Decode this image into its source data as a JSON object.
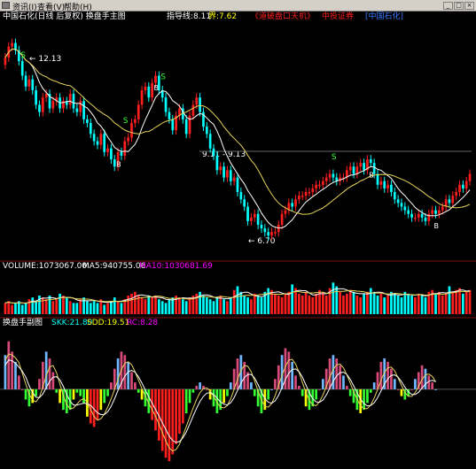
{
  "menu": {
    "items": [
      "资讯(I)",
      "查看(V)",
      "帮助(H)"
    ]
  },
  "main_panel": {
    "title": "中国石化(日线 后复权) 换盘手主图",
    "indicator": "指导线:8.11",
    "boundary": "界:7.62",
    "promo1": "《道破盘口天机》",
    "promo2": "中投证券",
    "stock_link": "[中国石化]",
    "annotations": {
      "high": "12.13",
      "mid": "9.11 - 9.13",
      "low": "6.70"
    },
    "markers": {
      "sell": "S",
      "buy": "B"
    }
  },
  "volume_panel": {
    "vol": "VOLUME:1073067.00",
    "ma5": "MA5:940755.06",
    "ma10": "MA10:1030681.69"
  },
  "sub_panel": {
    "name": "换盘手副图",
    "skk": "SKK:21.80",
    "sdd": "SDD:19.51",
    "rc": "RC:8.28"
  },
  "colors": {
    "up": "#ff1e1e",
    "down": "#00ffff",
    "ma5": "#ffffff",
    "ma10": "#e6d45c",
    "green": "#33ff33",
    "pink": "#d84a7a",
    "blue": "#70b8ff",
    "yellow": "#ffff00",
    "magenta_label": "#ff00ff",
    "cyan_label": "#00ffff",
    "yellow_label": "#ffff00"
  },
  "chart_data": {
    "type": "candlestick",
    "price_ylim": [
      6.2,
      12.6
    ],
    "close": [
      11.7,
      12.0,
      12.1,
      11.9,
      11.6,
      11.2,
      10.9,
      11.1,
      10.8,
      10.4,
      10.2,
      10.6,
      10.7,
      10.3,
      10.5,
      10.6,
      10.3,
      10.5,
      10.4,
      10.7,
      10.3,
      10.2,
      10.5,
      10.0,
      9.9,
      9.6,
      9.4,
      9.3,
      9.6,
      9.1,
      9.2,
      8.9,
      8.7,
      9.1,
      9.0,
      9.4,
      9.5,
      9.9,
      10.0,
      10.4,
      10.8,
      10.9,
      10.6,
      11.0,
      11.2,
      10.8,
      10.6,
      10.2,
      10.0,
      9.7,
      10.1,
      10.3,
      10.0,
      9.6,
      10.1,
      10.4,
      10.6,
      10.2,
      9.8,
      9.6,
      9.2,
      9.0,
      8.6,
      8.7,
      8.4,
      8.6,
      8.3,
      8.4,
      8.0,
      7.8,
      7.6,
      7.2,
      7.3,
      7.4,
      7.1,
      7.0,
      6.9,
      6.8,
      6.9,
      6.9,
      7.1,
      7.4,
      7.5,
      7.7,
      7.6,
      7.8,
      7.9,
      7.9,
      8.0,
      8.0,
      8.1,
      8.2,
      8.2,
      8.3,
      8.4,
      8.5,
      8.4,
      8.3,
      8.4,
      8.4,
      8.6,
      8.7,
      8.5,
      8.7,
      8.8,
      8.6,
      8.9,
      8.8,
      8.5,
      8.2,
      8.3,
      8.1,
      8.2,
      8.0,
      7.8,
      7.7,
      7.6,
      7.5,
      7.4,
      7.3,
      7.3,
      7.4,
      7.3,
      7.2,
      7.4,
      7.5,
      7.4,
      7.5,
      7.6,
      7.8,
      7.7,
      7.9,
      8.0,
      8.2,
      8.1,
      8.3,
      8.5
    ],
    "volume": [
      0.6,
      0.7,
      0.5,
      0.6,
      0.7,
      0.5,
      0.6,
      0.8,
      0.9,
      0.7,
      1.0,
      0.9,
      0.8,
      1.0,
      0.7,
      0.8,
      1.1,
      1.0,
      0.9,
      0.7,
      0.6,
      0.6,
      0.8,
      0.9,
      0.7,
      0.6,
      0.7,
      0.6,
      0.8,
      0.5,
      0.6,
      0.7,
      0.9,
      0.7,
      0.6,
      0.8,
      1.0,
      1.1,
      1.2,
      1.0,
      0.9,
      0.8,
      1.0,
      0.9,
      1.0,
      0.8,
      0.7,
      0.6,
      0.8,
      0.9,
      1.0,
      0.9,
      0.8,
      0.7,
      0.9,
      1.0,
      1.1,
      1.2,
      1.0,
      0.9,
      0.8,
      0.7,
      0.9,
      1.0,
      0.8,
      0.7,
      0.9,
      1.3,
      1.5,
      1.2,
      1.0,
      0.9,
      0.8,
      1.1,
      1.0,
      0.9,
      1.2,
      1.4,
      1.3,
      1.1,
      1.0,
      0.9,
      1.1,
      1.2,
      1.6,
      1.4,
      1.1,
      1.0,
      1.2,
      1.0,
      0.9,
      1.1,
      1.3,
      1.2,
      1.0,
      1.4,
      1.7,
      1.5,
      1.2,
      1.0,
      1.1,
      1.3,
      1.2,
      1.0,
      0.9,
      1.1,
      1.2,
      1.4,
      1.2,
      1.0,
      1.1,
      0.9,
      1.0,
      1.2,
      1.1,
      1.0,
      0.9,
      1.2,
      1.1,
      1.0,
      0.9,
      1.1,
      1.0,
      0.9,
      1.2,
      1.3,
      1.1,
      1.2,
      1.0,
      1.1,
      1.5,
      1.2,
      1.3,
      1.4,
      1.1,
      1.2,
      1.3
    ],
    "volume_ylim": [
      0,
      2.0
    ],
    "oscillator": [
      1.0,
      1.4,
      1.1,
      0.8,
      0.4,
      0.0,
      -0.3,
      -0.5,
      -0.4,
      -0.2,
      0.3,
      0.8,
      1.1,
      0.9,
      0.5,
      -0.1,
      -0.4,
      -0.6,
      -0.7,
      -0.6,
      -0.3,
      -0.1,
      -0.2,
      -0.4,
      -0.8,
      -1.0,
      -1.1,
      -0.9,
      -0.6,
      -0.4,
      -0.2,
      0.2,
      0.6,
      0.9,
      1.1,
      1.0,
      0.8,
      0.5,
      0.2,
      -0.1,
      -0.3,
      -0.5,
      -0.7,
      -0.9,
      -1.2,
      -1.5,
      -1.8,
      -2.0,
      -2.1,
      -1.9,
      -1.6,
      -1.3,
      -1.0,
      -0.7,
      -0.4,
      -0.1,
      0.1,
      0.2,
      0.1,
      0.0,
      -0.3,
      -0.5,
      -0.7,
      -0.6,
      -0.4,
      -0.2,
      0.2,
      0.6,
      0.9,
      1.0,
      0.8,
      0.5,
      0.2,
      -0.2,
      -0.5,
      -0.7,
      -0.6,
      -0.3,
      0.0,
      0.3,
      0.7,
      1.0,
      1.2,
      1.1,
      0.8,
      0.4,
      0.1,
      -0.2,
      -0.5,
      -0.6,
      -0.5,
      -0.3,
      0.0,
      0.3,
      0.6,
      0.9,
      1.0,
      0.9,
      0.7,
      0.4,
      0.1,
      -0.2,
      -0.4,
      -0.6,
      -0.7,
      -0.6,
      -0.4,
      -0.1,
      0.2,
      0.5,
      0.8,
      0.9,
      0.8,
      0.6,
      0.3,
      0.0,
      -0.2,
      -0.3,
      -0.2,
      0.0,
      0.3,
      0.5,
      0.7,
      0.6,
      0.4,
      0.2,
      0.0
    ],
    "oscillator_ylim": [
      -2.2,
      1.6
    ]
  }
}
